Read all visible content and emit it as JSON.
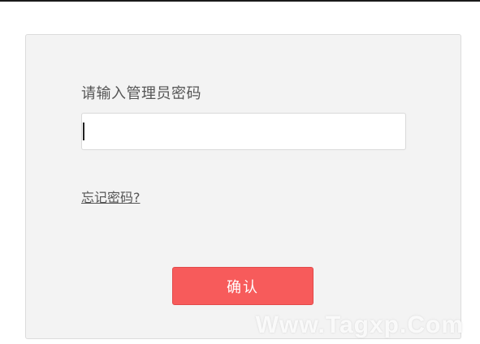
{
  "login": {
    "prompt": "请输入管理员密码",
    "password_value": "",
    "forgot_link": "忘记密码?",
    "confirm_label": "确认"
  },
  "watermark": "Www.Tagxp.Com",
  "colors": {
    "panel_bg": "#f3f3f3",
    "button_bg": "#f75b5b",
    "text": "#555555"
  }
}
